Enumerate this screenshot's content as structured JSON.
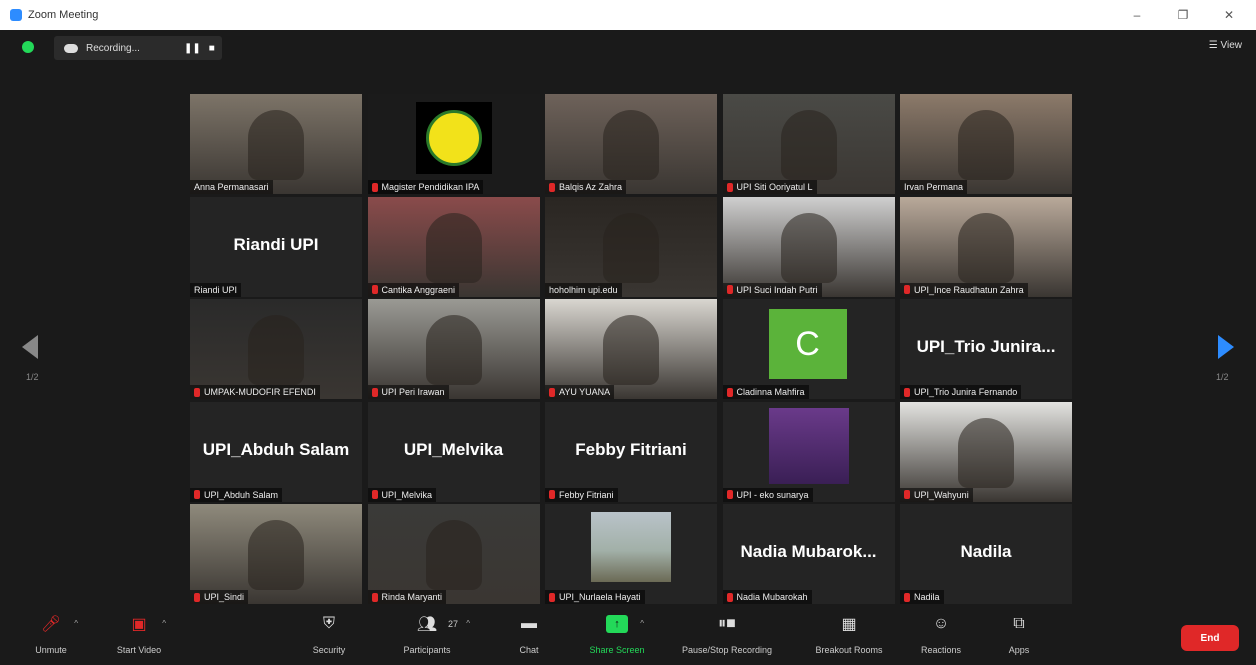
{
  "window": {
    "title": "Zoom Meeting",
    "minimize": "–",
    "maximize": "❐",
    "close": "✕"
  },
  "topbar": {
    "recording_label": "Recording...",
    "pause_icon": "❚❚",
    "stop_icon": "■",
    "view_label": "☰ View"
  },
  "pagination": {
    "left": "1/2",
    "right": "1/2"
  },
  "tiles": [
    {
      "label": "Anna Permanasari",
      "muted": false,
      "kind": "video",
      "bg": "#7d7468",
      "active": false
    },
    {
      "label": "Magister Pendidikan IPA",
      "muted": true,
      "kind": "logo",
      "bg": "#1b1b1b",
      "active": false
    },
    {
      "label": "Balqis Az Zahra",
      "muted": true,
      "kind": "video",
      "bg": "#6e625a",
      "active": false
    },
    {
      "label": "UPI Siti Ooriyatul L",
      "muted": true,
      "kind": "video",
      "bg": "#4a4a46",
      "active": false
    },
    {
      "label": "Irvan Permana",
      "muted": false,
      "kind": "video",
      "bg": "#8c7a6a",
      "active": true
    },
    {
      "label": "Riandi UPI",
      "muted": false,
      "kind": "name",
      "big": "Riandi UPI",
      "bg": "#242424",
      "active": false
    },
    {
      "label": "Cantika Anggraeni",
      "muted": true,
      "kind": "video",
      "bg": "#8a4b4b",
      "active": false
    },
    {
      "label": "hoholhim upi.edu",
      "muted": false,
      "kind": "video",
      "bg": "#2a2622",
      "active": false
    },
    {
      "label": "UPI Suci Indah Putri",
      "muted": true,
      "kind": "video",
      "bg": "#cfcfcf",
      "active": false
    },
    {
      "label": "UPI_Ince Raudhatun Zahra",
      "muted": true,
      "kind": "video",
      "bg": "#b9a99a",
      "active": false
    },
    {
      "label": "UMPAK-MUDOFIR EFENDI",
      "muted": true,
      "kind": "video",
      "bg": "#2a2a2a",
      "active": false
    },
    {
      "label": "UPI Peri Irawan",
      "muted": true,
      "kind": "video",
      "bg": "#9a9a94",
      "active": false
    },
    {
      "label": "AYU YUANA",
      "muted": true,
      "kind": "video",
      "bg": "#d9d6d0",
      "active": false
    },
    {
      "label": "Cladinna Mahfira",
      "muted": true,
      "kind": "avatar",
      "letter": "C",
      "bg": "#242424",
      "active": false
    },
    {
      "label": "UPI_Trio Junira Fernando",
      "muted": true,
      "kind": "name",
      "big": "UPI_Trio  Junira...",
      "bg": "#242424",
      "active": false
    },
    {
      "label": "UPI_Abduh Salam",
      "muted": true,
      "kind": "name",
      "big": "UPI_Abduh Salam",
      "bg": "#242424",
      "active": false
    },
    {
      "label": "UPI_Melvika",
      "muted": true,
      "kind": "name",
      "big": "UPI_Melvika",
      "bg": "#242424",
      "active": false
    },
    {
      "label": "Febby Fitriani",
      "muted": true,
      "kind": "name",
      "big": "Febby Fitriani",
      "bg": "#242424",
      "active": false
    },
    {
      "label": "UPI - eko sunarya",
      "muted": true,
      "kind": "slide",
      "bg": "#242424",
      "active": false
    },
    {
      "label": "UPI_Wahyuni",
      "muted": true,
      "kind": "video",
      "bg": "#e3e3e0",
      "active": false
    },
    {
      "label": "UPI_Sindi",
      "muted": true,
      "kind": "video",
      "bg": "#8f8a7c",
      "active": false
    },
    {
      "label": "Rinda Maryanti",
      "muted": true,
      "kind": "video",
      "bg": "#3a3a38",
      "active": false
    },
    {
      "label": "UPI_Nurlaela Hayati",
      "muted": true,
      "kind": "photo",
      "bg": "#242424",
      "active": false
    },
    {
      "label": "Nadia Mubarokah",
      "muted": true,
      "kind": "name",
      "big": "Nadia  Mubarok...",
      "bg": "#242424",
      "active": false
    },
    {
      "label": "Nadila",
      "muted": true,
      "kind": "name",
      "big": "Nadila",
      "bg": "#242424",
      "active": false
    }
  ],
  "toolbar": {
    "unmute": "Unmute",
    "start_video": "Start Video",
    "security": "Security",
    "participants": "Participants",
    "participants_count": "27",
    "chat": "Chat",
    "share_screen": "Share Screen",
    "pause_stop_recording": "Pause/Stop Recording",
    "breakout_rooms": "Breakout Rooms",
    "reactions": "Reactions",
    "apps": "Apps",
    "end": "End"
  },
  "colors": {
    "accent": "#2d8cff",
    "share": "#23d959",
    "end": "#e02828",
    "active_speaker": "#c8e85a"
  }
}
